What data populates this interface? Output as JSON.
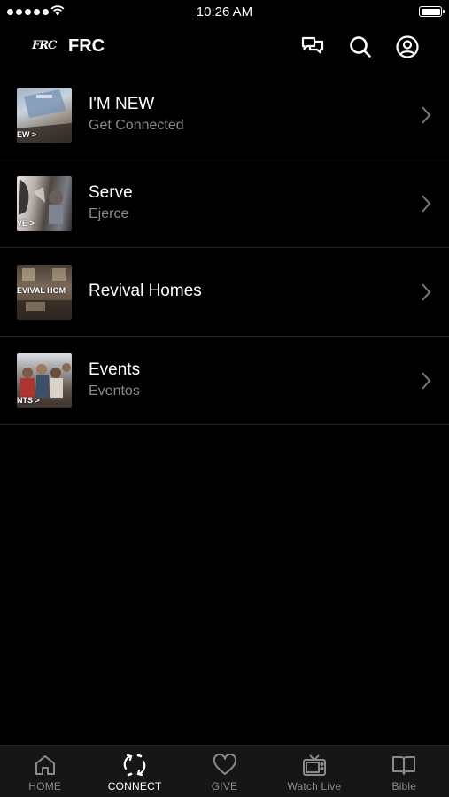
{
  "status_bar": {
    "time": "10:26 AM",
    "signal_bars": 5,
    "battery_level": 1.0
  },
  "header": {
    "logo_text": "FRC",
    "title": "FRC",
    "icons": [
      "chat-icon",
      "search-icon",
      "account-icon"
    ]
  },
  "list": [
    {
      "title": "I'M NEW",
      "subtitle": "Get Connected",
      "thumb_caption": "EW  >",
      "thumb_icon": "im-new-thumbnail"
    },
    {
      "title": "Serve",
      "subtitle": "Ejerce",
      "thumb_caption": "VE  >",
      "thumb_icon": "serve-thumbnail"
    },
    {
      "title": "Revival Homes",
      "subtitle": "",
      "thumb_caption": "EVIVAL HOM",
      "thumb_icon": "revival-homes-thumbnail"
    },
    {
      "title": "Events",
      "subtitle": "Eventos",
      "thumb_caption": "NTS  >",
      "thumb_icon": "events-thumbnail"
    }
  ],
  "tabs": [
    {
      "label": "HOME",
      "icon": "home-icon",
      "active": false
    },
    {
      "label": "CONNECT",
      "icon": "connect-icon",
      "active": true
    },
    {
      "label": "GIVE",
      "icon": "heart-icon",
      "active": false
    },
    {
      "label": "Watch Live",
      "icon": "tv-icon",
      "active": false
    },
    {
      "label": "Bible",
      "icon": "book-icon",
      "active": false
    }
  ],
  "colors": {
    "background": "#000000",
    "tab_bar": "#161616",
    "divider": "#262626",
    "subtitle": "#8a8a8a",
    "active_tab": "#ffffff",
    "inactive_tab": "#8a8a8a"
  }
}
